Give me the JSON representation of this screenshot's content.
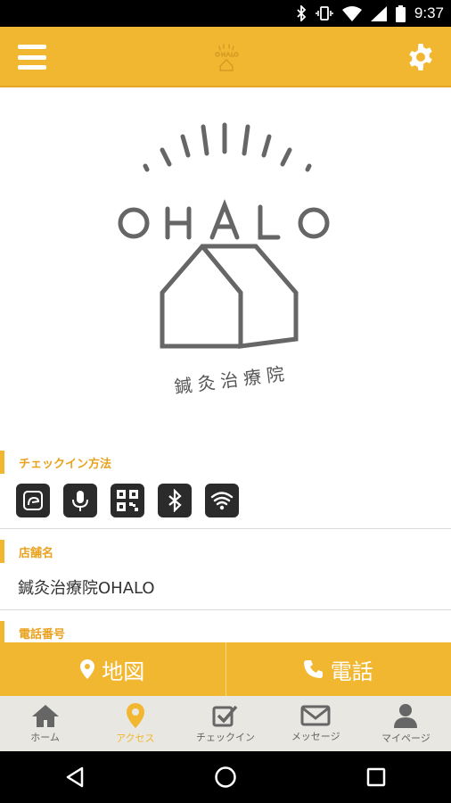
{
  "status_bar": {
    "time": "9:37",
    "icons": [
      "bluetooth-icon",
      "vibrate-icon",
      "wifi-icon",
      "signal-icon",
      "battery-icon"
    ]
  },
  "header": {
    "menu_icon": "hamburger-menu-icon",
    "logo_icon": "ohalo-small-logo",
    "settings_icon": "gear-icon"
  },
  "logo": {
    "brand": "OHALO",
    "subtitle": "鍼灸治療院"
  },
  "checkin": {
    "title": "チェックイン方法",
    "methods": [
      "touch-icon",
      "microphone-icon",
      "qr-code-icon",
      "bluetooth-icon",
      "wifi-icon"
    ]
  },
  "store": {
    "title": "店舗名",
    "name": "鍼灸治療院OHALO"
  },
  "phone": {
    "title": "電話番号"
  },
  "actions": {
    "map_label": "地図",
    "call_label": "電話"
  },
  "bottom_nav": {
    "items": [
      {
        "label": "ホーム",
        "icon": "home-icon"
      },
      {
        "label": "アクセス",
        "icon": "location-pin-icon"
      },
      {
        "label": "チェックイン",
        "icon": "checkbox-icon"
      },
      {
        "label": "メッセージ",
        "icon": "envelope-icon"
      },
      {
        "label": "マイページ",
        "icon": "person-icon"
      }
    ]
  },
  "colors": {
    "accent": "#f2b731",
    "accent_text": "#e8a21f",
    "icon_dark": "#2b2b2b"
  }
}
